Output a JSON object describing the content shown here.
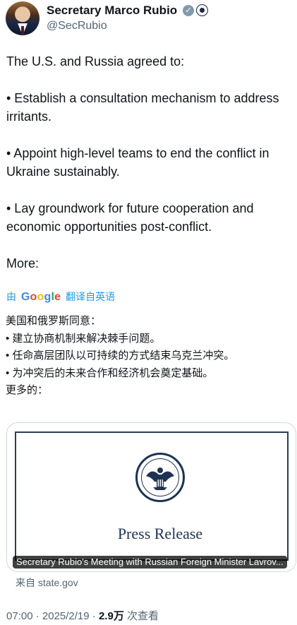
{
  "author": {
    "name": "Secretary Marco Rubio",
    "handle": "@SecRubio",
    "verified_mark": "✓"
  },
  "tweet": {
    "text": "The U.S. and Russia agreed to:\n\n• Establish a consultation mechanism to address irritants.\n\n• Appoint high-level teams to end the conflict in Ukraine sustainably.\n\n• Lay groundwork for future cooperation and economic opportunities post-conflict.\n\nMore:"
  },
  "translation": {
    "prefix": "由",
    "google_letters": [
      "G",
      "o",
      "o",
      "g",
      "l",
      "e"
    ],
    "suffix": "翻译自英语",
    "text": "美国和俄罗斯同意：\n• 建立协商机制来解决棘手问题。\n• 任命高层团队以可持续的方式结束乌克兰冲突。\n• 为冲突后的未来合作和经济机会奠定基础。\n更多的："
  },
  "card": {
    "title": "Press Release",
    "caption": "Secretary Rubio's Meeting with Russian Foreign Minister Lavrov...",
    "source": "来自 state.gov"
  },
  "meta": {
    "time": "07:00",
    "separator": " · ",
    "date": "2025/2/19",
    "views_count": "2.9万",
    "views_label": " 次查看"
  },
  "colors": {
    "link_blue": "#1d9bf0",
    "seal_navy": "#1e3354",
    "muted_text": "#536471"
  },
  "icons": [
    "verified-badge-icon",
    "government-affiliation-icon",
    "department-of-state-seal-icon"
  ]
}
